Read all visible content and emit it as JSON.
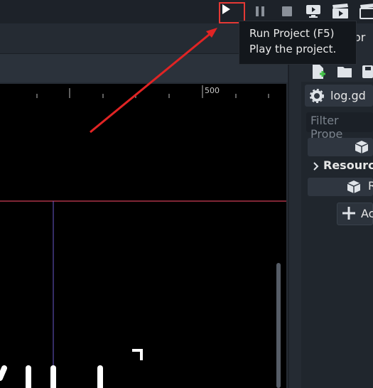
{
  "toolbar": {
    "items": [
      "play-icon",
      "pause-icon",
      "stop-icon",
      "remote-debug-icon",
      "play-scene-icon",
      "play-custom-scene-icon"
    ],
    "edge_text": "or"
  },
  "tooltip": {
    "title": "Run Project (F5)",
    "description": "Play the project."
  },
  "viewport": {
    "ruler_label": "500"
  },
  "inspector": {
    "file_name": "log.gd",
    "filter_placeholder": "Filter Prope",
    "resource_label": "Resourc",
    "sub_label": "R",
    "add_label": "Ac"
  },
  "colors": {
    "highlight": "#e53935",
    "arrow": "#e02424",
    "axis_x": "#ff4d6a",
    "axis_y": "#6a5acd"
  }
}
